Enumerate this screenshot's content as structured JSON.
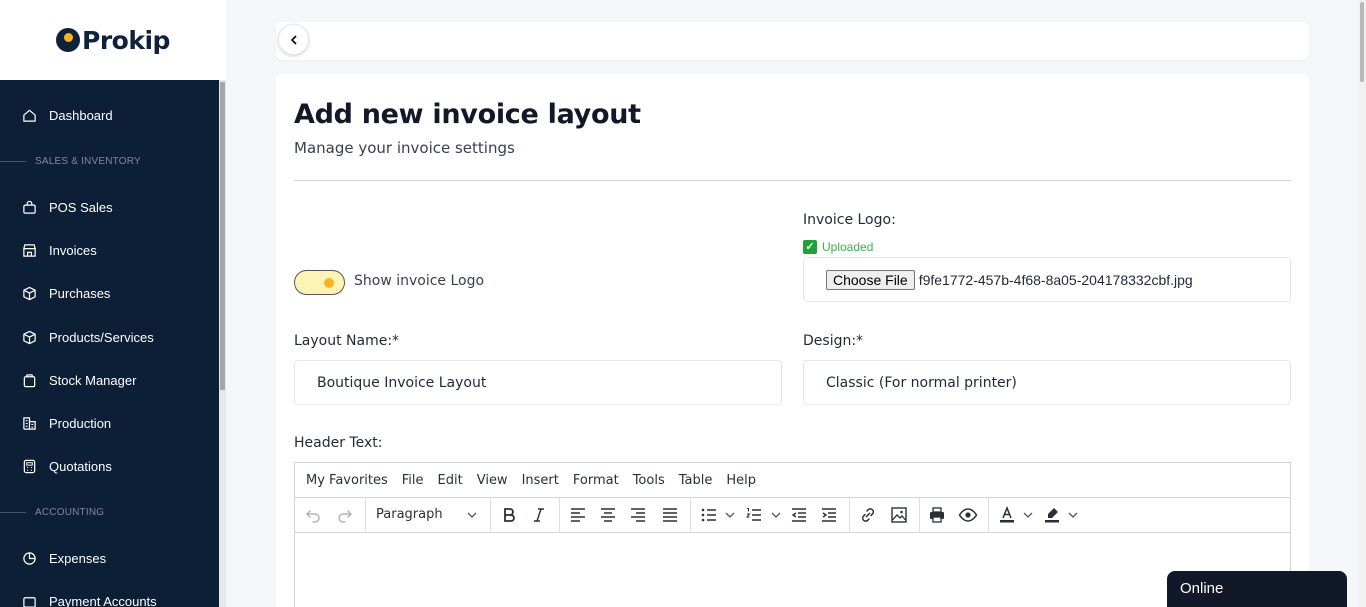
{
  "app": {
    "brand": "Prokip"
  },
  "sidebar": {
    "items": [
      {
        "label": "Dashboard",
        "icon": "home-icon"
      },
      {
        "label": "POS Sales",
        "icon": "shopping-bag-icon"
      },
      {
        "label": "Invoices",
        "icon": "store-icon"
      },
      {
        "label": "Purchases",
        "icon": "package-icon"
      },
      {
        "label": "Products/Services",
        "icon": "box-icon"
      },
      {
        "label": "Stock Manager",
        "icon": "bag-icon"
      },
      {
        "label": "Production",
        "icon": "factory-icon"
      },
      {
        "label": "Quotations",
        "icon": "calculator-icon"
      },
      {
        "label": "Expenses",
        "icon": "pie-chart-icon"
      },
      {
        "label": "Payment Accounts",
        "icon": "wallet-icon"
      }
    ],
    "sections": {
      "sales_inventory": "SALES & INVENTORY",
      "accounting": "ACCOUNTING"
    }
  },
  "page": {
    "title": "Add new invoice layout",
    "subtitle": "Manage your invoice settings"
  },
  "form": {
    "show_logo_label": "Show invoice Logo",
    "show_logo_enabled": true,
    "invoice_logo_label": "Invoice Logo:",
    "uploaded_status": "Uploaded",
    "choose_file_label": "Choose File",
    "file_name": "f9fe1772-457b-4f68-8a05-204178332cbf.jpg",
    "layout_name_label": "Layout Name:*",
    "layout_name_value": "Boutique Invoice Layout",
    "design_label": "Design:*",
    "design_value": "Classic (For normal printer)",
    "header_text_label": "Header Text:"
  },
  "editor": {
    "menu": [
      "My Favorites",
      "File",
      "Edit",
      "View",
      "Insert",
      "Format",
      "Tools",
      "Table",
      "Help"
    ],
    "block_format": "Paragraph"
  },
  "chat": {
    "status": "Online"
  },
  "colors": {
    "sidebar_bg": "#0d1f36",
    "accent": "#f6b51e",
    "success": "#3bb34a"
  }
}
